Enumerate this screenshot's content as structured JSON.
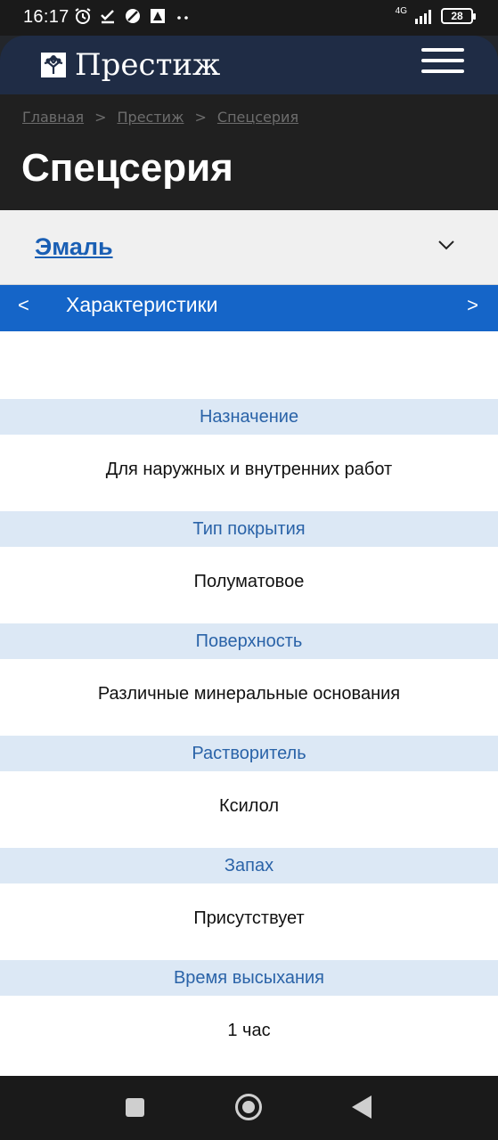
{
  "status": {
    "time": "16:17",
    "network": "4G",
    "battery": "28",
    "icons": [
      "alarm-icon",
      "check-icon",
      "no-disturb-icon",
      "app-notification-icon",
      "more-dots-icon",
      "signal-icon",
      "battery-icon"
    ]
  },
  "header": {
    "logo_text": "Престиж",
    "logo_icon": "tree-logo-icon",
    "menu_icon": "hamburger-menu-icon"
  },
  "breadcrumb": {
    "items": [
      "Главная",
      "Престиж",
      "Спецсерия"
    ],
    "separator": ">"
  },
  "page_title": "Спецсерия",
  "accordion": {
    "title": "Эмаль",
    "chevron_icon": "chevron-down-icon"
  },
  "tabs": {
    "prev": "<",
    "label": "Характеристики",
    "next": ">"
  },
  "specs": [
    {
      "name": "Назначение",
      "value": "Для наружных и внутренних работ"
    },
    {
      "name": "Тип покрытия",
      "value": "Полуматовое"
    },
    {
      "name": "Поверхность",
      "value": "Различные минеральные основания"
    },
    {
      "name": "Растворитель",
      "value": "Ксилол"
    },
    {
      "name": "Запах",
      "value": "Присутствует"
    },
    {
      "name": "Время высыхания",
      "value": "1 час"
    }
  ],
  "colors": {
    "header_bg": "#1f2c45",
    "accent_blue": "#1565c8",
    "spec_head_bg": "#dce8f5",
    "spec_head_text": "#2a63a8",
    "link_blue": "#1a5fb4"
  },
  "navbar": {
    "icons": [
      "recent-apps-icon",
      "home-icon",
      "back-icon"
    ]
  }
}
